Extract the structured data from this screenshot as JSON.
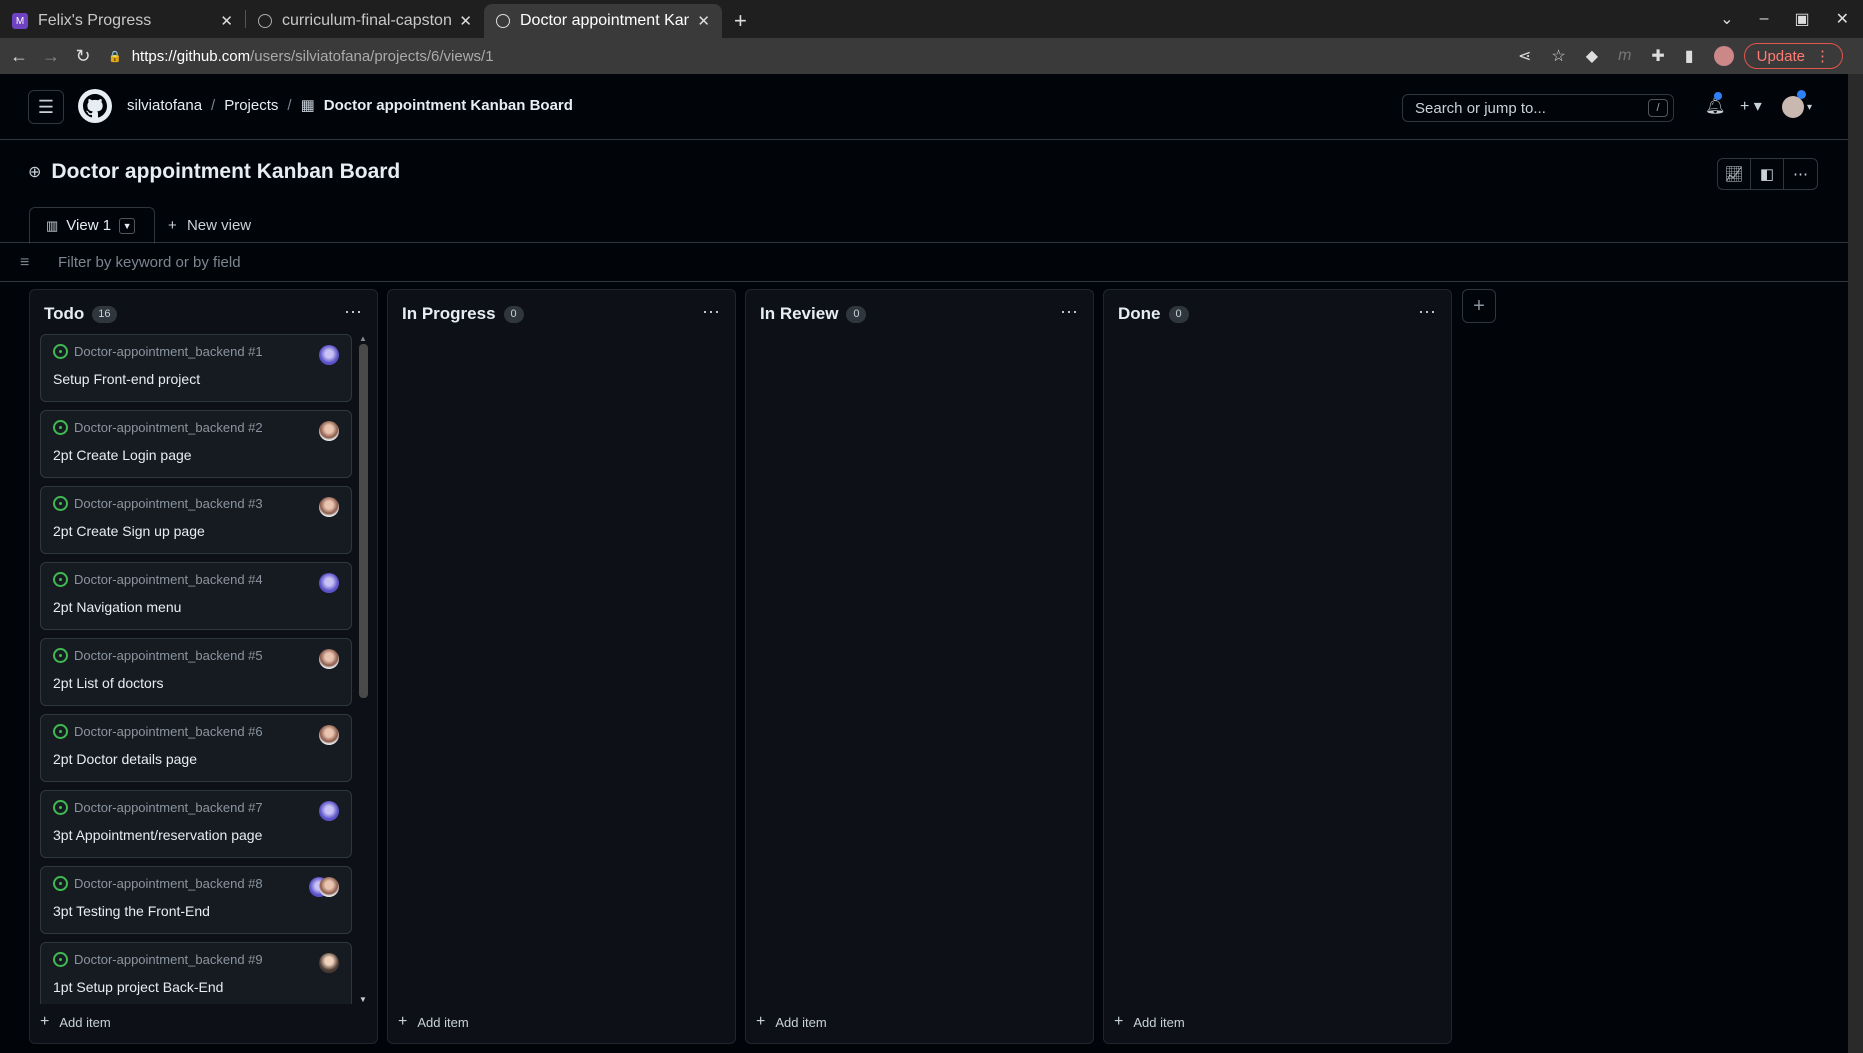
{
  "browser": {
    "tabs": [
      {
        "title": "Felix's Progress",
        "close": "✕"
      },
      {
        "title": "curriculum-final-capstone",
        "close": "✕"
      },
      {
        "title": "Doctor appointment Kanban Board",
        "close": "✕"
      }
    ],
    "url_host": "https://github.com",
    "url_path": "/users/silviatofana/projects/6/views/1",
    "update_label": "Update"
  },
  "header": {
    "breadcrumb_user": "silviatofana",
    "breadcrumb_projects": "Projects",
    "breadcrumb_project": "Doctor appointment Kanban Board",
    "search_placeholder": "Search or jump to...",
    "search_key": "/"
  },
  "project": {
    "title": "Doctor appointment Kanban Board",
    "view_tab": "View 1",
    "new_view": "New view",
    "filter_placeholder": "Filter by keyword or by field"
  },
  "board": {
    "add_item": "Add item",
    "columns": [
      {
        "name": "Todo",
        "count": "16"
      },
      {
        "name": "In Progress",
        "count": "0"
      },
      {
        "name": "In Review",
        "count": "0"
      },
      {
        "name": "Done",
        "count": "0"
      }
    ],
    "todo_cards": [
      {
        "repo": "Doctor-appointment_backend #1",
        "title": "Setup Front-end project",
        "avatar": "a"
      },
      {
        "repo": "Doctor-appointment_backend #2",
        "title": "2pt Create Login page",
        "avatar": "b"
      },
      {
        "repo": "Doctor-appointment_backend #3",
        "title": "2pt Create Sign up page",
        "avatar": "b"
      },
      {
        "repo": "Doctor-appointment_backend #4",
        "title": "2pt Navigation menu",
        "avatar": "a"
      },
      {
        "repo": "Doctor-appointment_backend #5",
        "title": "2pt List of doctors",
        "avatar": "b"
      },
      {
        "repo": "Doctor-appointment_backend #6",
        "title": "2pt Doctor details page",
        "avatar": "b"
      },
      {
        "repo": "Doctor-appointment_backend #7",
        "title": "3pt Appointment/reservation page",
        "avatar": "a"
      },
      {
        "repo": "Doctor-appointment_backend #8",
        "title": "3pt Testing the Front-End",
        "avatar": "ab"
      },
      {
        "repo": "Doctor-appointment_backend #9",
        "title": "1pt Setup project Back-End",
        "avatar": "c"
      }
    ]
  }
}
